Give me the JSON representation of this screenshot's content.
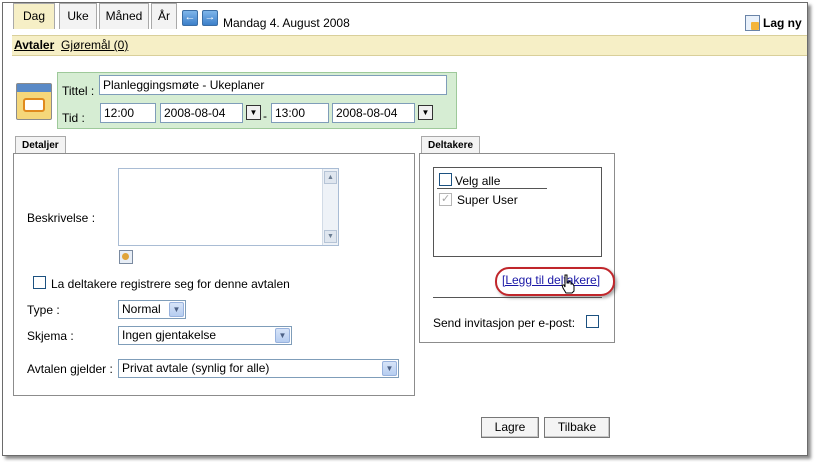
{
  "nav": {
    "tabs": [
      {
        "label": "Dag"
      },
      {
        "label": "Uke"
      },
      {
        "label": "Måned"
      },
      {
        "label": "År"
      }
    ],
    "prev_icon": "arrow-left-icon",
    "next_icon": "arrow-right-icon",
    "date": "Mandag 4. August 2008",
    "new_label": "Lag ny"
  },
  "subnav": {
    "appointments": "Avtaler",
    "tasks": "Gjøremål (0)"
  },
  "form": {
    "title_label": "Tittel :",
    "title_value": "Planleggingsmøte - Ukeplaner",
    "time_label": "Tid :",
    "start_time": "12:00",
    "start_date": "2008-08-04",
    "separator": "-",
    "end_time": "13:00",
    "end_date": "2008-08-04"
  },
  "details": {
    "tab_label": "Detaljer",
    "description_label": "Beskrivelse :",
    "register_label": "La deltakere registrere seg for denne avtalen",
    "type_label": "Type :",
    "type_value": "Normal",
    "schema_label": "Skjema :",
    "schema_value": "Ingen gjentakelse",
    "applies_label": "Avtalen gjelder :",
    "applies_value": "Privat avtale (synlig for alle)"
  },
  "participants": {
    "tab_label": "Deltakere",
    "select_all": "Velg alle",
    "users": [
      "Super User"
    ],
    "add_link": "[Legg til deltakere]",
    "invite_label": "Send invitasjon per e-post:"
  },
  "actions": {
    "save": "Lagre",
    "back": "Tilbake"
  },
  "colors": {
    "active_tab": "#f6efc6",
    "title_panel": "#d6edd3",
    "highlight_oval": "#c0262b"
  }
}
